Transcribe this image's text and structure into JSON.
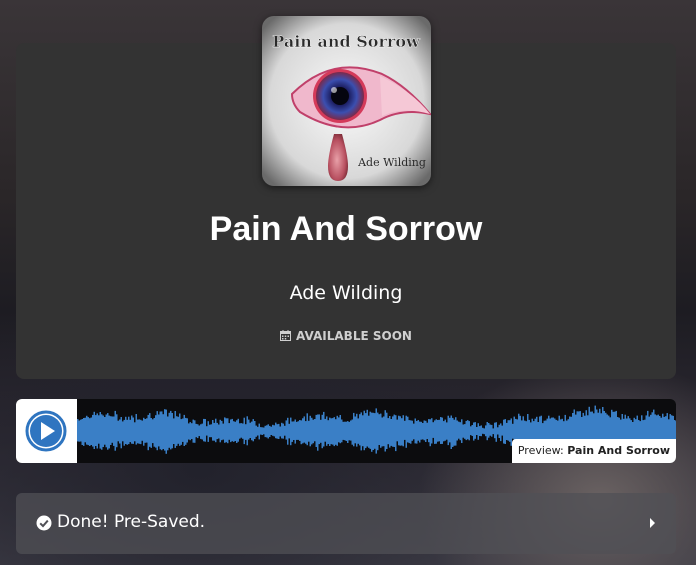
{
  "release": {
    "title": "Pain And Sorrow",
    "artist": "Ade Wilding",
    "availability": "AVAILABLE SOON",
    "availability_icon": "calendar-icon",
    "cover_art": {
      "title_text": "Pain and Sorrow",
      "artist_text": "Ade Wilding"
    }
  },
  "player": {
    "play_icon": "play-icon",
    "preview_prefix": "Preview:",
    "preview_track": "Pain And Sorrow",
    "waveform_color": "#3a7fc6"
  },
  "status": {
    "icon": "check-circle-icon",
    "text": "Done! Pre-Saved.",
    "chevron_icon": "chevron-right-icon"
  }
}
